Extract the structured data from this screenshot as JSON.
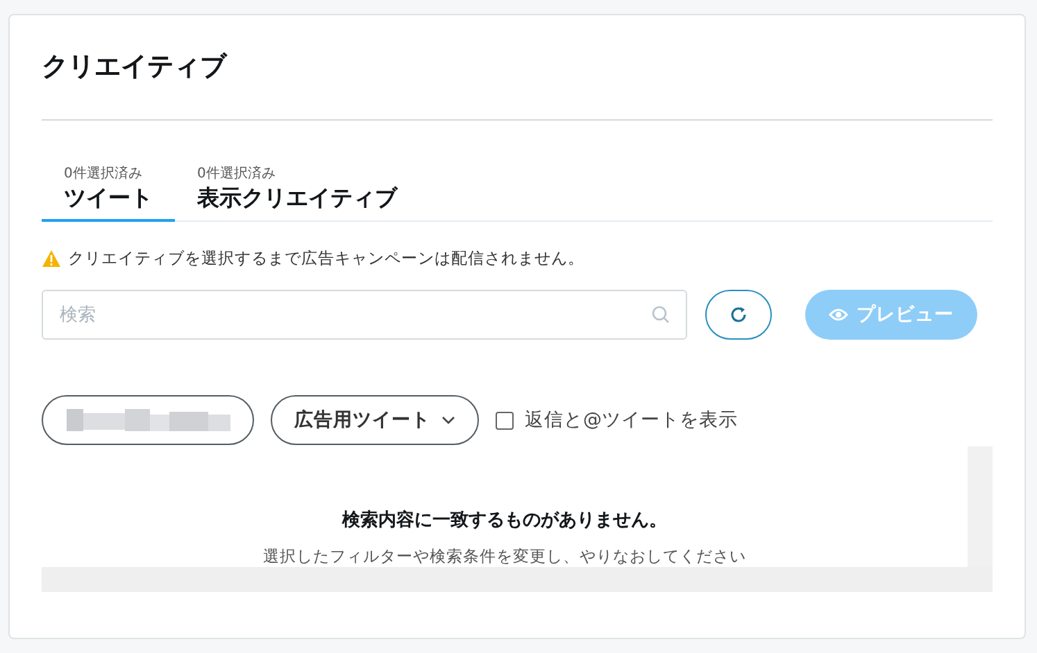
{
  "title": "クリエイティブ",
  "tabs": [
    {
      "count": "0件選択済み",
      "label": "ツイート",
      "selected": true
    },
    {
      "count": "0件選択済み",
      "label": "表示クリエイティブ",
      "selected": false
    }
  ],
  "warning": "クリエイティブを選択するまで広告キャンペーンは配信されません。",
  "search": {
    "placeholder": "検索"
  },
  "preview_button": {
    "label": "プレビュー",
    "disabled": true
  },
  "tweet_type_dropdown": {
    "label": "広告用ツイート"
  },
  "show_replies": {
    "label": "返信と@ツイートを表示",
    "checked": false
  },
  "empty_state": {
    "title": "検索内容に一致するものがありません。",
    "message": "選択したフィルターや検索条件を変更し、やりなおしてください"
  }
}
